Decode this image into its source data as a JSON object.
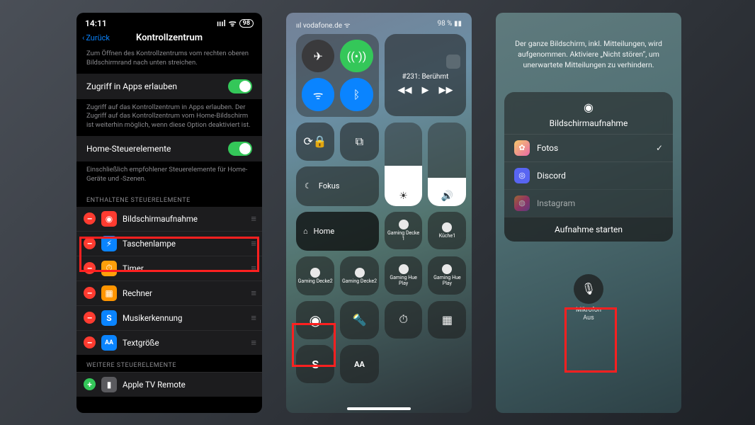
{
  "p1": {
    "status_time": "14:11",
    "status_battery": "98",
    "back_label": "Zurück",
    "title": "Kontrollzentrum",
    "desc1": "Zum Öffnen des Kontrollzentrums vom rechten oberen Bildschirmrand nach unten streichen.",
    "toggle1_label": "Zugriff in Apps erlauben",
    "toggle1_desc": "Zugriff auf das Kontrollzentrum in Apps erlauben. Der Zugriff auf das Kontrollzentrum vom Home-Bildschirm ist weiterhin möglich, wenn diese Option deaktiviert ist.",
    "toggle2_label": "Home-Steuerelemente",
    "toggle2_desc": "Einschließlich empfohlener Steuerelemente für Home-Geräte und -Szenen.",
    "section_included": "ENTHALTENE STEUERELEMENTE",
    "rows": [
      {
        "label": "Bildschirmaufnahme",
        "icon": "◉",
        "bg": "#ff3b30"
      },
      {
        "label": "Taschenlampe",
        "icon": "⚡︎",
        "bg": "#0a84ff"
      },
      {
        "label": "Timer",
        "icon": "⏱",
        "bg": "#ff9f0a"
      },
      {
        "label": "Rechner",
        "icon": "▦",
        "bg": "#ff9500"
      },
      {
        "label": "Musikerkennung",
        "icon": "S",
        "bg": "#0a84ff"
      },
      {
        "label": "Textgröße",
        "icon": "AA",
        "bg": "#0a84ff"
      }
    ],
    "section_more": "WEITERE STEUERELEMENTE",
    "more_row_label": "Apple TV Remote"
  },
  "p2": {
    "carrier": "vodafone.de",
    "battery_text": "98 %",
    "media_title": "#231: Berühmt",
    "focus_label": "Fokus",
    "home_label": "Home",
    "minis1": [
      "Gaming Decke 1",
      "Küche1"
    ],
    "minis2": [
      "Gaming Decke2",
      "Gaming Decke2",
      "Gaming Hue Play",
      "Gaming Hue Play"
    ]
  },
  "p3": {
    "message": "Der ganze Bildschirm, inkl. Mitteilungen, wird aufgenommen. Aktiviere „Nicht stören“, um unerwartete Mitteilungen zu verhindern.",
    "sheet_title": "Bildschirmaufnahme",
    "apps": [
      {
        "label": "Fotos",
        "bg": "linear-gradient(135deg,#f6c96a,#e96aa7)",
        "checked": true
      },
      {
        "label": "Discord",
        "bg": "#5865f2",
        "checked": false
      },
      {
        "label": "Instagram",
        "bg": "linear-gradient(135deg,#f58529,#dd2a7b,#8134af)",
        "checked": false
      }
    ],
    "start_label": "Aufnahme starten",
    "mic_label": "Mikrofon",
    "mic_state": "Aus"
  }
}
